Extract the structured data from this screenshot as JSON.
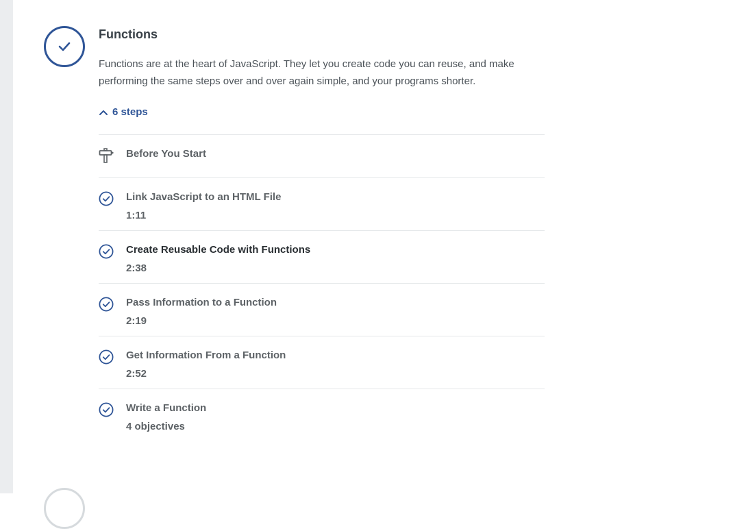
{
  "stage": {
    "title": "Functions",
    "description": "Functions are at the heart of JavaScript. They let you create code you can reuse, and make performing the same steps over and over again simple, and your programs shorter.",
    "status": "complete",
    "steps_toggle_label": "6 steps"
  },
  "steps": [
    {
      "type": "intro",
      "icon": "signpost-icon",
      "title": "Before You Start"
    },
    {
      "type": "video",
      "icon": "check-circle-icon",
      "title": "Link JavaScript to an HTML File",
      "meta": "1:11"
    },
    {
      "type": "video",
      "icon": "check-circle-icon",
      "title": "Create Reusable Code with Functions",
      "meta": "2:38",
      "active": true
    },
    {
      "type": "video",
      "icon": "check-circle-icon",
      "title": "Pass Information to a Function",
      "meta": "2:19"
    },
    {
      "type": "video",
      "icon": "check-circle-icon",
      "title": "Get Information From a Function",
      "meta": "2:52"
    },
    {
      "type": "practice",
      "icon": "check-circle-icon",
      "title": "Write a Function",
      "meta": "4 objectives"
    }
  ],
  "colors": {
    "accent": "#2f5597",
    "text_primary": "#384047",
    "text_secondary": "#5d6266",
    "divider": "#e5e8ea",
    "rail": "#ebedef"
  }
}
